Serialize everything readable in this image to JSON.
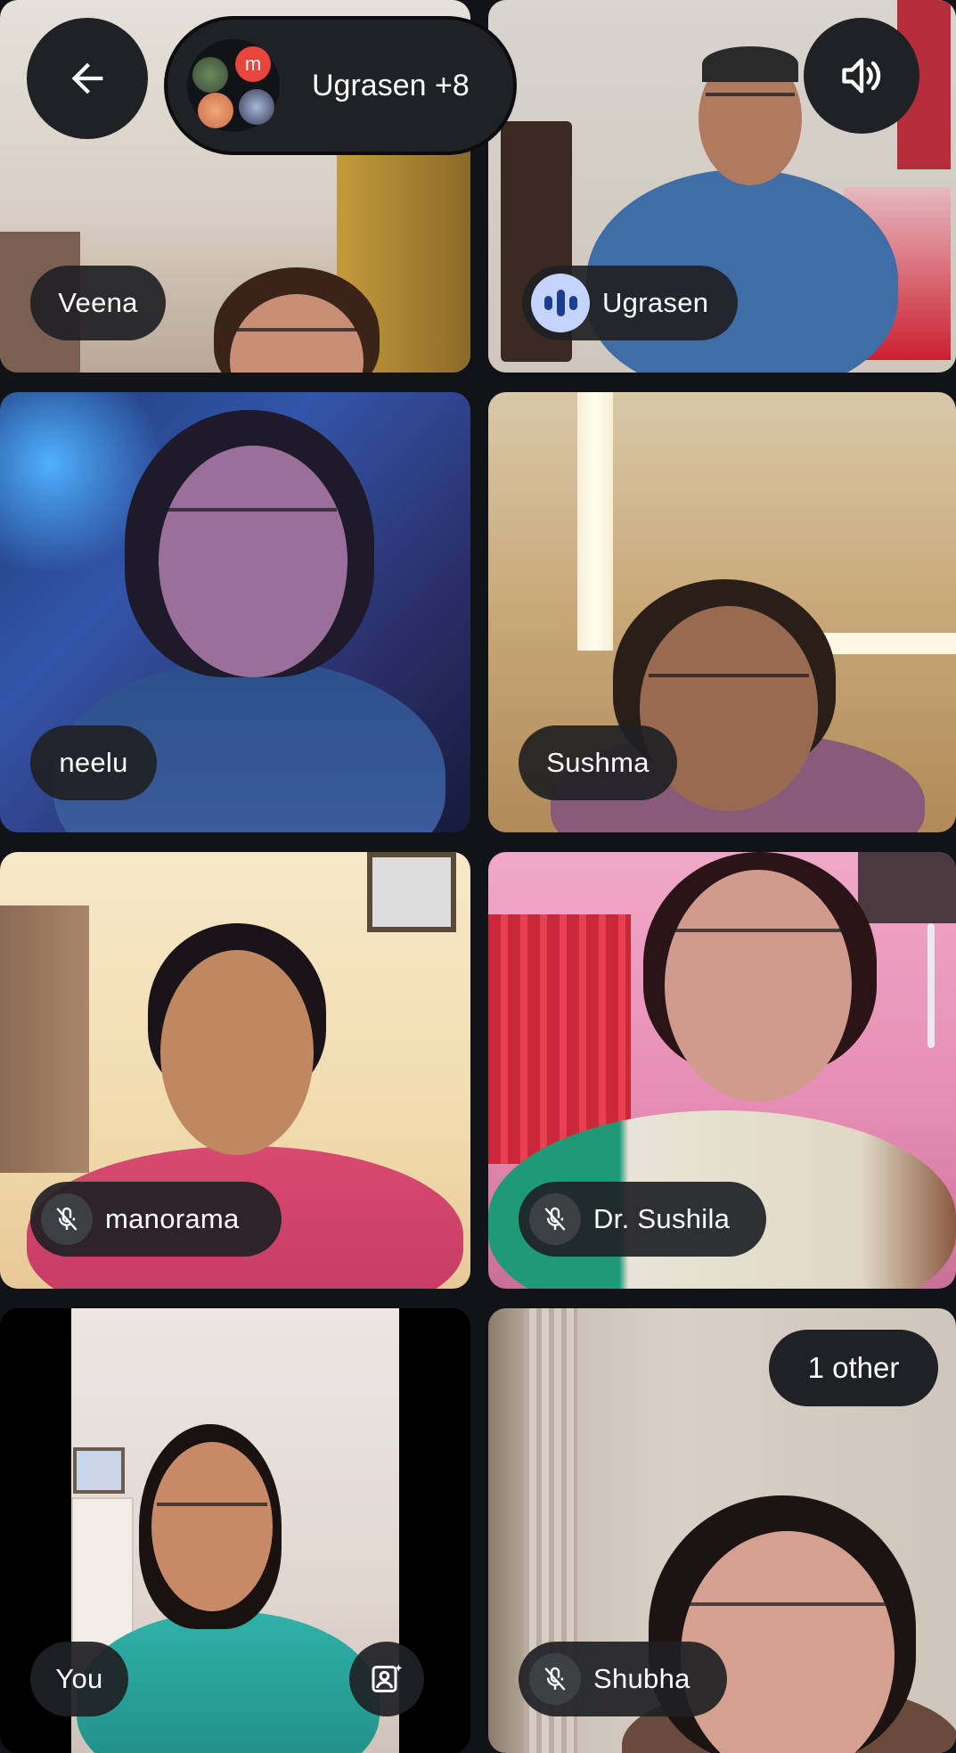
{
  "header": {
    "participants_label": "Ugrasen +8",
    "avatar_initial": "m"
  },
  "tiles": [
    {
      "name": "Veena"
    },
    {
      "name": "Ugrasen"
    },
    {
      "name": "neelu"
    },
    {
      "name": "Sushma"
    },
    {
      "name": "manorama"
    },
    {
      "name": "Dr. Sushila"
    },
    {
      "name": "You"
    },
    {
      "name": "Shubha"
    }
  ],
  "others": {
    "label": "1 other"
  },
  "colors": {
    "background": "#121316",
    "pill": "#202124",
    "active_outline": "#8fa3d8",
    "speaking_badge": "#c5d4ff",
    "avatar_red": "#e8453c"
  },
  "icons": {
    "back": "arrow-left-icon",
    "volume": "volume-up-icon",
    "mic_off": "mic-off-icon",
    "speaking": "audio-level-icon",
    "effects": "portrait-effects-icon"
  }
}
